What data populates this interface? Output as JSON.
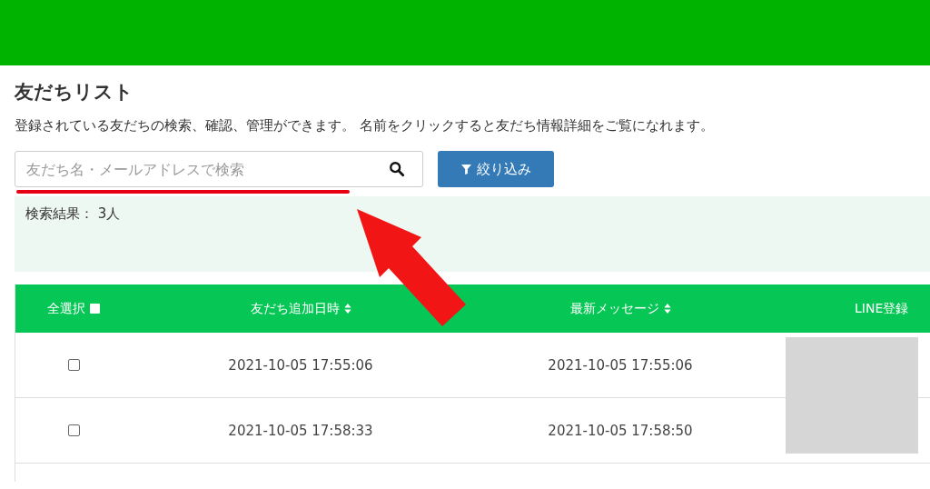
{
  "title": "友だちリスト",
  "description": "登録されている友だちの検索、確認、管理ができます。 名前をクリックすると友だち情報詳細をご覧になれます。",
  "search": {
    "placeholder": "友だち名・メールアドレスで検索"
  },
  "filter_button": "絞り込み",
  "results": "検索結果： 3人",
  "table": {
    "select_all": {
      "label": "全選択",
      "checked": false
    },
    "columns": [
      {
        "label": "友だち追加日時",
        "sortable": true
      },
      {
        "label": "最新メッセージ",
        "sortable": true
      },
      {
        "label": "LINE登録"
      }
    ],
    "rows": [
      {
        "checked": false,
        "added": "2021-10-05 17:55:06",
        "latest": "2021-10-05 17:55:06"
      },
      {
        "checked": false,
        "added": "2021-10-05 17:58:33",
        "latest": "2021-10-05 17:58:50"
      }
    ]
  }
}
